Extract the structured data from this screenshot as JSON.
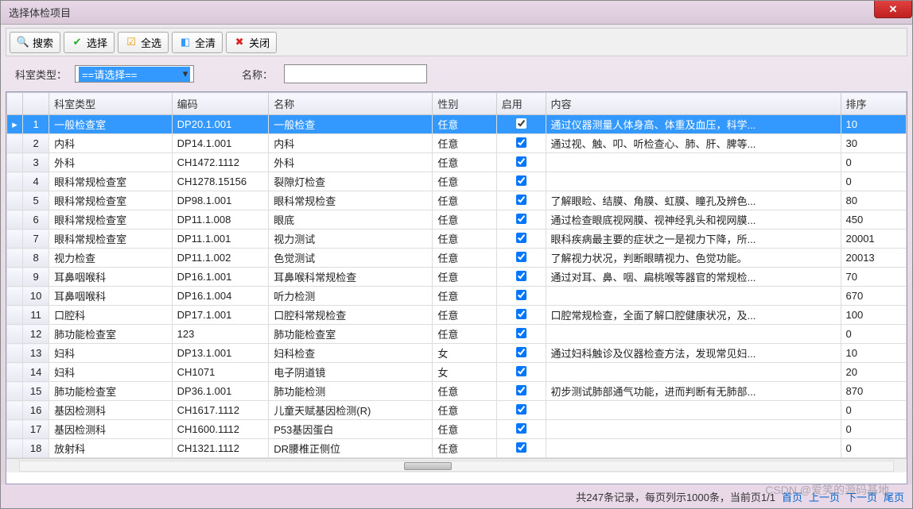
{
  "window": {
    "title": "选择体检项目"
  },
  "toolbar": {
    "search": "搜索",
    "select": "选择",
    "select_all": "全选",
    "clear_all": "全清",
    "close": "关闭"
  },
  "filter": {
    "dept_label": "科室类型：",
    "dept_value": "==请选择==",
    "name_label": "名称：",
    "name_value": ""
  },
  "columns": {
    "dept": "科室类型",
    "code": "编码",
    "name": "名称",
    "gender": "性别",
    "enable": "启用",
    "content": "内容",
    "order": "排序"
  },
  "rows": [
    {
      "n": 1,
      "dept": "一般检查室",
      "code": "DP20.1.001",
      "name": "一般检查",
      "gender": "任意",
      "enable": true,
      "content": "通过仪器测量人体身高、体重及血压，科学...",
      "order": "10",
      "sel": true
    },
    {
      "n": 2,
      "dept": "内科",
      "code": "DP14.1.001",
      "name": "内科",
      "gender": "任意",
      "enable": true,
      "content": "通过视、触、叩、听检查心、肺、肝、脾等...",
      "order": "30"
    },
    {
      "n": 3,
      "dept": "外科",
      "code": "CH1472.1112",
      "name": "外科",
      "gender": "任意",
      "enable": true,
      "content": "",
      "order": "0"
    },
    {
      "n": 4,
      "dept": "眼科常规检查室",
      "code": "CH1278.15156",
      "name": "裂隙灯检查",
      "gender": "任意",
      "enable": true,
      "content": "",
      "order": "0"
    },
    {
      "n": 5,
      "dept": "眼科常规检查室",
      "code": "DP98.1.001",
      "name": "眼科常规检查",
      "gender": "任意",
      "enable": true,
      "content": "了解眼睑、结膜、角膜、虹膜、瞳孔及辨色...",
      "order": "80"
    },
    {
      "n": 6,
      "dept": "眼科常规检查室",
      "code": "DP11.1.008",
      "name": "眼底",
      "gender": "任意",
      "enable": true,
      "content": "通过检查眼底视网膜、视神经乳头和视网膜...",
      "order": "450"
    },
    {
      "n": 7,
      "dept": "眼科常规检查室",
      "code": "DP11.1.001",
      "name": "视力测试",
      "gender": "任意",
      "enable": true,
      "content": "眼科疾病最主要的症状之一是视力下降，所...",
      "order": "20001"
    },
    {
      "n": 8,
      "dept": "视力检查",
      "code": "DP11.1.002",
      "name": "色觉测试",
      "gender": "任意",
      "enable": true,
      "content": "了解视力状况，判断眼睛视力、色觉功能。",
      "order": "20013"
    },
    {
      "n": 9,
      "dept": "耳鼻咽喉科",
      "code": "DP16.1.001",
      "name": "耳鼻喉科常规检查",
      "gender": "任意",
      "enable": true,
      "content": "通过对耳、鼻、咽、扁桃喉等器官的常规检...",
      "order": "70"
    },
    {
      "n": 10,
      "dept": "耳鼻咽喉科",
      "code": "DP16.1.004",
      "name": "听力检测",
      "gender": "任意",
      "enable": true,
      "content": "",
      "order": "670"
    },
    {
      "n": 11,
      "dept": "口腔科",
      "code": "DP17.1.001",
      "name": "口腔科常规检查",
      "gender": "任意",
      "enable": true,
      "content": "口腔常规检查，全面了解口腔健康状况，及...",
      "order": "100"
    },
    {
      "n": 12,
      "dept": "肺功能检查室",
      "code": "123",
      "name": "肺功能检查室",
      "gender": "任意",
      "enable": true,
      "content": "",
      "order": "0"
    },
    {
      "n": 13,
      "dept": "妇科",
      "code": "DP13.1.001",
      "name": "妇科检查",
      "gender": "女",
      "enable": true,
      "content": "通过妇科触诊及仪器检查方法，发现常见妇...",
      "order": "10"
    },
    {
      "n": 14,
      "dept": "妇科",
      "code": "CH1071",
      "name": "电子阴道镜",
      "gender": "女",
      "enable": true,
      "content": "",
      "order": "20"
    },
    {
      "n": 15,
      "dept": "肺功能检查室",
      "code": "DP36.1.001",
      "name": "肺功能检测",
      "gender": "任意",
      "enable": true,
      "content": "初步测试肺部通气功能，进而判断有无肺部...",
      "order": "870"
    },
    {
      "n": 16,
      "dept": "基因检测科",
      "code": "CH1617.1112",
      "name": "儿童天赋基因检测(R)",
      "gender": "任意",
      "enable": true,
      "content": "",
      "order": "0"
    },
    {
      "n": 17,
      "dept": "基因检测科",
      "code": "CH1600.1112",
      "name": "P53基因蛋白",
      "gender": "任意",
      "enable": true,
      "content": "",
      "order": "0"
    },
    {
      "n": 18,
      "dept": "放射科",
      "code": "CH1321.1112",
      "name": "DR腰椎正侧位",
      "gender": "任意",
      "enable": true,
      "content": "",
      "order": "0"
    }
  ],
  "pager": {
    "summary": "共247条记录，每页列示1000条，当前页1/1",
    "first": "首页",
    "prev": "上一页",
    "next": "下一页",
    "last": "尾页"
  },
  "watermark": "CSDN @爱笑的源码基地"
}
